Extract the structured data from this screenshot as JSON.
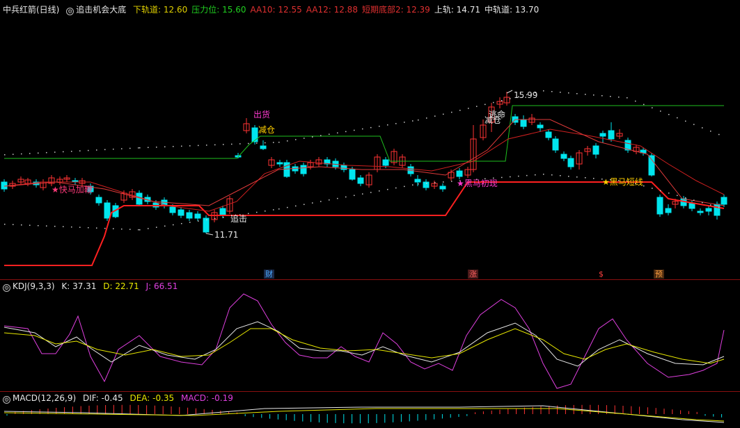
{
  "main_header": {
    "stock": "中兵红箭(日线)",
    "indicator": "追击机会大底",
    "items": [
      {
        "label": "下轨道: 12.60",
        "color": "#e0d000"
      },
      {
        "label": "压力位: 15.60",
        "color": "#20d020"
      },
      {
        "label": "AA10: 12.55",
        "color": "#e03030"
      },
      {
        "label": "AA12: 12.88",
        "color": "#e03030"
      },
      {
        "label": "短期底部2: 12.39",
        "color": "#e03030"
      },
      {
        "label": "上轨: 14.71",
        "color": "#e8e8e8"
      },
      {
        "label": "中轨道: 13.70",
        "color": "#e8e8e8"
      }
    ]
  },
  "price_labels": {
    "high": "15.99",
    "low": "11.71",
    "sell": "出货",
    "reduce": "减仓",
    "chase": "追击",
    "escape": "逃命",
    "reduce2": "减仓",
    "kuaima": "★快马加鞭",
    "heima1": "★黑马初现",
    "heima2": "★黑马短线"
  },
  "event_badges": [
    {
      "label": "财",
      "color": "#4aa8ff"
    },
    {
      "label": "涨",
      "color": "#ff6060"
    },
    {
      "label": "$",
      "color": "#ff4040"
    },
    {
      "label": "预",
      "color": "#ffa040"
    }
  ],
  "kdj_header": {
    "name": "KDJ(9,3,3)",
    "k": "K: 37.31",
    "d": "D: 22.71",
    "j": "J: 66.51",
    "k_color": "#e8e8e8",
    "d_color": "#e8e800",
    "j_color": "#e040e0"
  },
  "macd_header": {
    "name": "MACD(12,26,9)",
    "dif": "DIF: -0.45",
    "dea": "DEA: -0.35",
    "macd": "MACD: -0.19",
    "dif_color": "#e8e8e8",
    "dea_color": "#e8e800",
    "macd_color": "#e040e0"
  },
  "colors": {
    "up": "#ff3333",
    "down": "#00e5ee",
    "background": "#000000",
    "border": "#8a1010"
  }
}
